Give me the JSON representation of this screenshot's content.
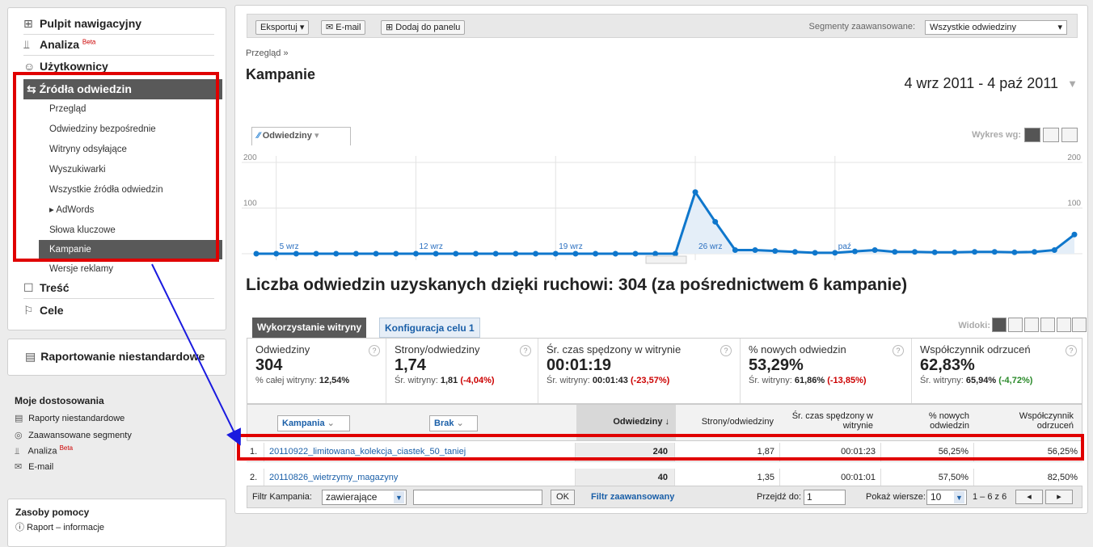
{
  "sidebar": {
    "nav": {
      "pulpit": "Pulpit nawigacyjny",
      "analiza": "Analiza",
      "analiza_badge": "Beta",
      "uzytkownicy": "Użytkownicy",
      "zrodla": "Źródła odwiedzin",
      "sub_items": [
        "Przegląd",
        "Odwiedziny bezpośrednie",
        "Witryny odsyłające",
        "Wyszukiwarki",
        "Wszystkie źródła odwiedzin",
        "AdWords",
        "Słowa kluczowe",
        "Kampanie",
        "Wersje reklamy"
      ],
      "tresc": "Treść",
      "cele": "Cele"
    },
    "custom_reporting": "Raportowanie niestandardowe",
    "moje": {
      "title": "Moje dostosowania",
      "items": [
        "Raporty niestandardowe",
        "Zaawansowane segmenty",
        "Analiza",
        "E-mail"
      ],
      "analiza_badge": "Beta"
    },
    "help": {
      "title": "Zasoby pomocy",
      "item": "Raport – informacje"
    }
  },
  "toolbar": {
    "export": "Eksportuj",
    "email": "E-mail",
    "add_to_panel": "Dodaj do panelu",
    "segments_label": "Segmenty zaawansowane:",
    "segments_value": "Wszystkie odwiedziny"
  },
  "breadcrumb": "Przegląd »",
  "page_title": "Kampanie",
  "date_range": "4 wrz 2011 - 4 paź 2011",
  "chart_controls": {
    "metric": "Odwiedziny",
    "graph_by": "Wykres wg:"
  },
  "chart_data": {
    "type": "line",
    "series": [
      {
        "name": "Odwiedziny",
        "values": [
          0,
          0,
          0,
          0,
          0,
          0,
          0,
          0,
          0,
          0,
          0,
          0,
          0,
          0,
          0,
          0,
          0,
          0,
          0,
          0,
          0,
          0,
          135,
          70,
          8,
          8,
          6,
          4,
          2,
          2,
          5,
          8,
          4,
          4,
          3,
          3,
          4,
          4,
          3,
          4,
          8,
          42
        ]
      }
    ],
    "ylim": [
      0,
      200
    ],
    "yticks": [
      "200",
      "100"
    ],
    "ytick_values": [
      200,
      100
    ],
    "xlabels": [
      "5 wrz",
      "12 wrz",
      "19 wrz",
      "26 wrz",
      "paź"
    ],
    "xlabel_index": [
      1,
      8,
      15,
      22,
      29
    ],
    "grid": true,
    "color": "#0f77cc"
  },
  "summary_title": "Liczba odwiedzin uzyskanych dzięki ruchowi: 304 (za pośrednictwem 6 kampanie)",
  "tabs": [
    "Wykorzystanie witryny",
    "Konfiguracja celu 1"
  ],
  "views_label": "Widoki:",
  "scorecards": [
    {
      "label": "Odwiedziny",
      "value": "304",
      "sub_prefix": "% całej witryny:",
      "sub_value": "12,54%",
      "sub_delta": ""
    },
    {
      "label": "Strony/odwiedziny",
      "value": "1,74",
      "sub_prefix": "Śr. witryny:",
      "sub_value": "1,81",
      "sub_delta": "(-4,04%)"
    },
    {
      "label": "Śr. czas spędzony w witrynie",
      "value": "00:01:19",
      "sub_prefix": "Śr. witryny:",
      "sub_value": "00:01:43",
      "sub_delta": "(-23,57%)"
    },
    {
      "label": "% nowych odwiedzin",
      "value": "53,29%",
      "sub_prefix": "Śr. witryny:",
      "sub_value": "61,86%",
      "sub_delta": "(-13,85%)"
    },
    {
      "label": "Współczynnik odrzuceń",
      "value": "62,83%",
      "sub_prefix": "Śr. witryny:",
      "sub_value": "65,94%",
      "sub_delta": "(-4,72%)"
    }
  ],
  "table": {
    "dim1": "Kampania",
    "dim2": "Brak",
    "columns": [
      "Odwiedziny",
      "Strony/odwiedziny",
      "Śr. czas spędzony w witrynie",
      "% nowych odwiedzin",
      "Współczynnik odrzuceń"
    ],
    "rows": [
      {
        "num": "1.",
        "campaign": "20110922_limitowana_kolekcja_ciastek_50_taniej",
        "visits": "240",
        "ppv": "1,87",
        "time": "00:01:23",
        "new": "56,25%",
        "bounce": "56,25%"
      },
      {
        "num": "2.",
        "campaign": "20110826_wietrzymy_magazyny",
        "visits": "40",
        "ppv": "1,35",
        "time": "00:01:01",
        "new": "57,50%",
        "bounce": "82,50%"
      }
    ]
  },
  "filter": {
    "label": "Filtr Kampania:",
    "mode": "zawierające",
    "ok": "OK",
    "advanced": "Filtr zaawansowany",
    "goto_label": "Przejdź do:",
    "goto_value": "1",
    "rows_label": "Pokaż wiersze:",
    "rows_value": "10",
    "range": "1 – 6 z 6"
  }
}
